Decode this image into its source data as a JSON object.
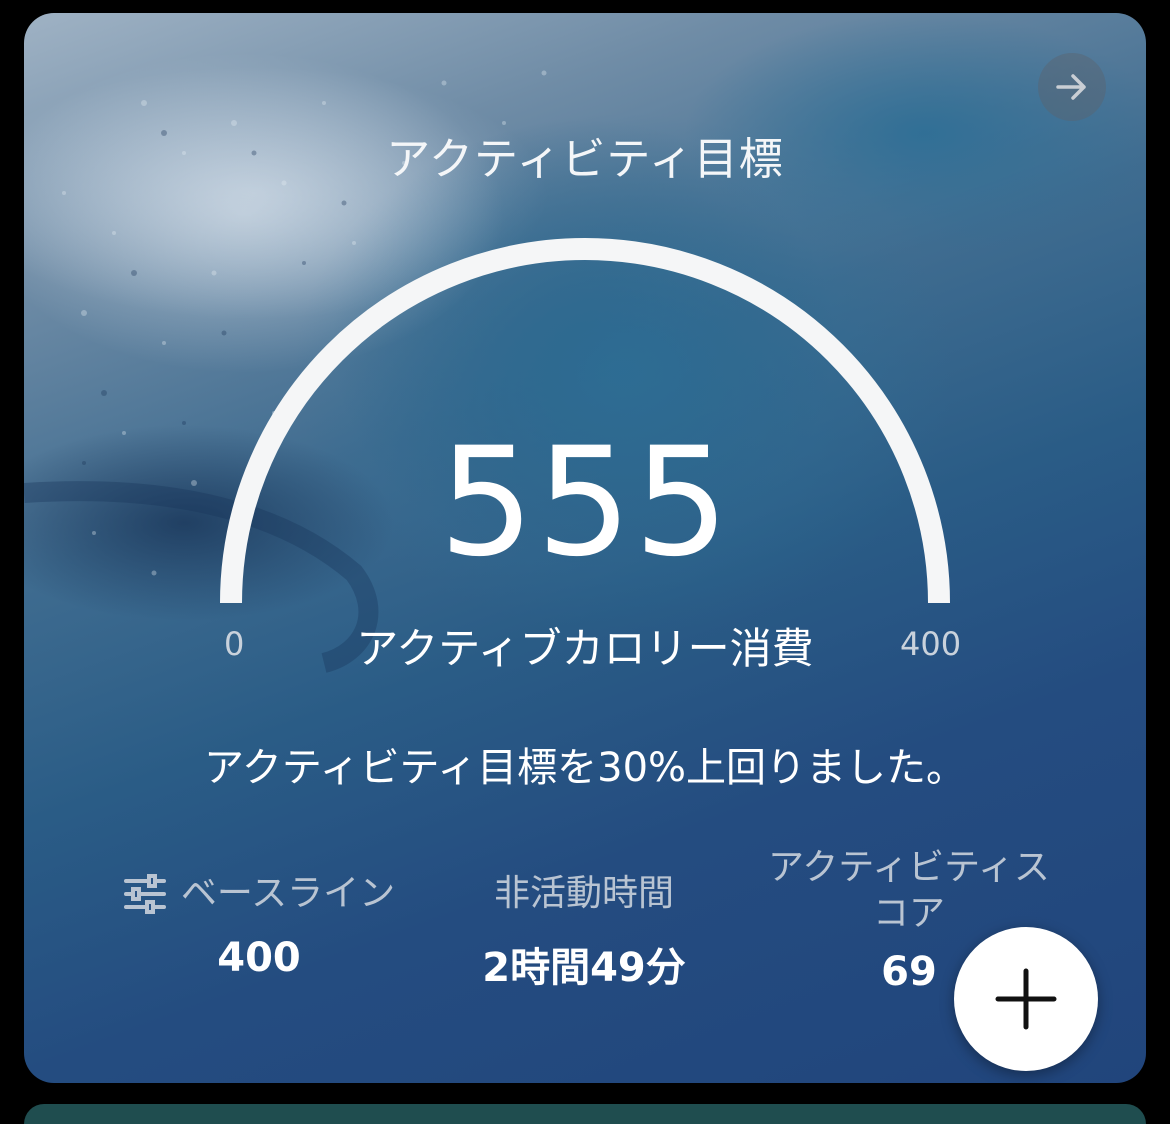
{
  "card": {
    "title": "アクティビティ目標",
    "gauge": {
      "value": "555",
      "label": "アクティブカロリー消費",
      "min_label": "0",
      "max_label": "400",
      "fill_fraction": 1.0
    },
    "message": "アクティビティ目標を30%上回りました。",
    "stats": [
      {
        "label": "ベースライン",
        "value": "400",
        "icon": "sliders-icon"
      },
      {
        "label": "非活動時間",
        "value": "2時間49分"
      },
      {
        "label": "アクティビティスコア",
        "label_line1": "アクティビティス",
        "label_line2": "コア",
        "value": "69"
      }
    ],
    "navigate_icon": "arrow-right-icon",
    "fab_icon": "plus-icon"
  },
  "colors": {
    "card_bottom": "#21457c",
    "card_top": "#9fb2c4",
    "gauge_arc": "#f5f6f7",
    "fab_background": "#ffffff"
  }
}
